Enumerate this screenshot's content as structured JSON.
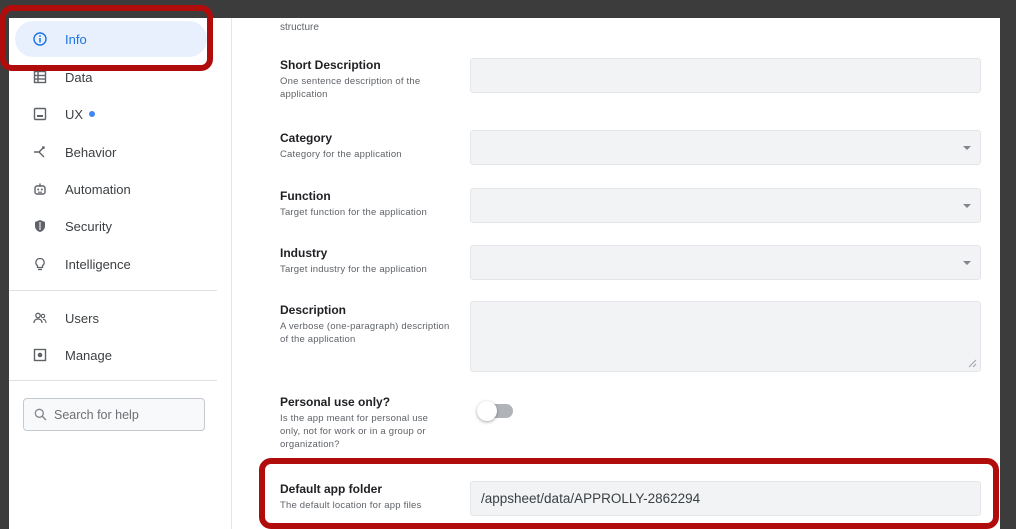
{
  "sidebar": {
    "items": [
      {
        "label": "Info",
        "icon": "info-icon",
        "active": true
      },
      {
        "label": "Data",
        "icon": "data-table-icon"
      },
      {
        "label": "UX",
        "icon": "ux-layout-icon",
        "dot": true
      },
      {
        "label": "Behavior",
        "icon": "behavior-branch-icon"
      },
      {
        "label": "Automation",
        "icon": "robot-icon"
      },
      {
        "label": "Security",
        "icon": "shield-icon"
      },
      {
        "label": "Intelligence",
        "icon": "lightbulb-icon"
      }
    ],
    "items2": [
      {
        "label": "Users",
        "icon": "users-icon"
      },
      {
        "label": "Manage",
        "icon": "manage-icon"
      }
    ],
    "search": {
      "placeholder": "Search for help"
    }
  },
  "form": {
    "fragment": "structure",
    "short_description": {
      "label": "Short Description",
      "desc": "One sentence description of the application"
    },
    "category": {
      "label": "Category",
      "desc": "Category for the application"
    },
    "function": {
      "label": "Function",
      "desc": "Target function for the application"
    },
    "industry": {
      "label": "Industry",
      "desc": "Target industry for the application"
    },
    "description": {
      "label": "Description",
      "desc": "A verbose (one-paragraph) description of the application"
    },
    "personal_use": {
      "label": "Personal use only?",
      "desc": "Is the app meant for personal use only, not for work or in a group or organization?",
      "value": false
    },
    "default_folder": {
      "label": "Default app folder",
      "desc": "The default location for app files",
      "value": "/appsheet/data/APPROLLY-2862294"
    }
  },
  "colors": {
    "accent": "#1a73e8",
    "highlight": "#b10c0c",
    "dot": "#4285f4"
  }
}
